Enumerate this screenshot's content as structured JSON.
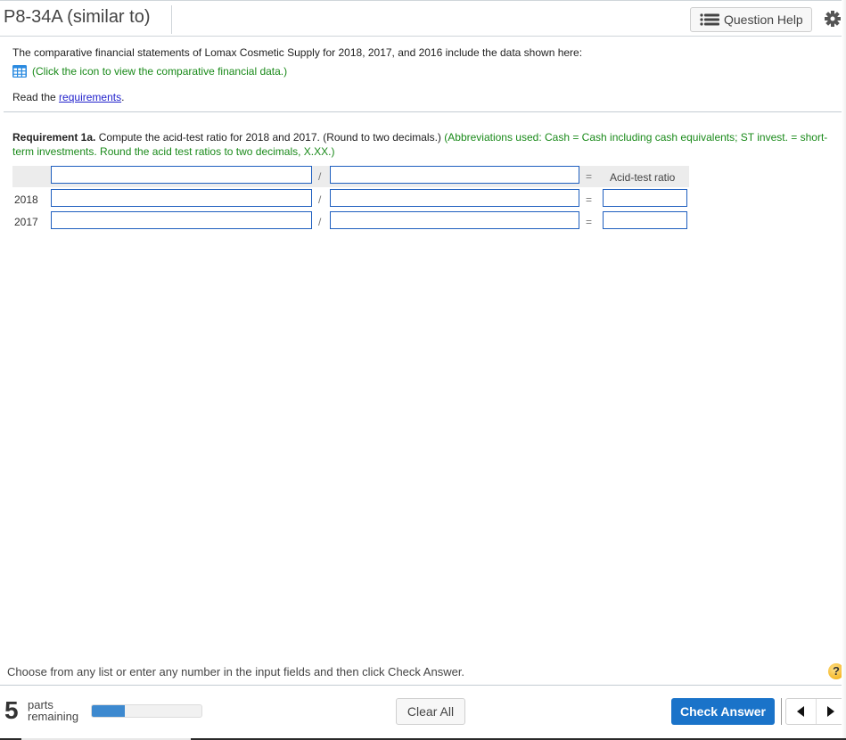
{
  "header": {
    "title": "P8-34A (similar to)",
    "question_help_label": "Question Help",
    "question_help_icon": "list-icon",
    "settings_icon": "gear-icon"
  },
  "intro": {
    "text": "The comparative financial statements of Lomax Cosmetic Supply for 2018, 2017, and 2016 include the data shown here:",
    "data_icon": "table-grid-icon",
    "data_link_text": "(Click the icon to view the comparative financial data.)",
    "read_prefix": "Read the ",
    "requirements_link": "requirements",
    "read_suffix": "."
  },
  "requirement": {
    "label": "Requirement 1a.",
    "text": " Compute the acid-test ratio for 2018 and 2017. (Round to two decimals.) ",
    "hint": "(Abbreviations used: Cash = Cash including cash equivalents; ST invest. = short-term investments. Round the acid test ratios to two decimals, X.XX.)"
  },
  "table": {
    "operator_divide": "/",
    "operator_equals": "=",
    "result_header": "Acid-test ratio",
    "header_inputs": {
      "numerator": "",
      "denominator": ""
    },
    "rows": [
      {
        "year": "2018",
        "numerator": "",
        "denominator": "",
        "result": ""
      },
      {
        "year": "2017",
        "numerator": "",
        "denominator": "",
        "result": ""
      }
    ]
  },
  "footer": {
    "instruction": "Choose from any list or enter any number in the input fields and then click Check Answer.",
    "help_symbol": "?",
    "parts_count": "5",
    "parts_label_1": "parts",
    "parts_label_2": "remaining",
    "progress_fraction": 0.3,
    "clear_all_label": "Clear All",
    "check_answer_label": "Check Answer",
    "prev_icon": "triangle-left-icon",
    "next_icon": "triangle-right-icon"
  },
  "colors": {
    "accent_blue": "#1a73c9",
    "hint_green": "#1a8a1a",
    "link_blue": "#2222cc",
    "input_border": "#1f5fbf",
    "progress_fill": "#3d89cf"
  }
}
